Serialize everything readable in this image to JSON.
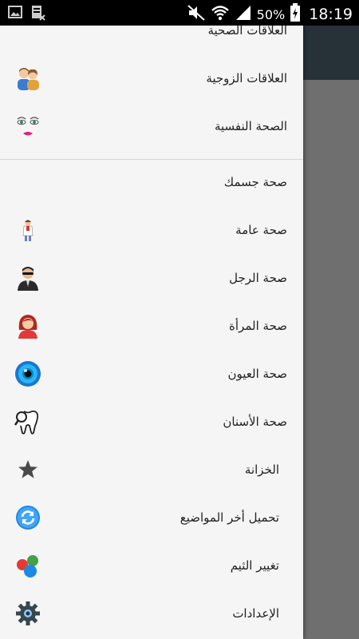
{
  "status_bar": {
    "battery": "50%",
    "time": "18:19",
    "icons": [
      "image-icon",
      "file-x-icon",
      "mute-icon",
      "wifi-icon",
      "signal-icon",
      "battery-charging-icon"
    ]
  },
  "drawer": {
    "group1": [
      {
        "label": "العلاقات الصحية",
        "icon": "none"
      },
      {
        "label": "العلاقات الزوجية",
        "icon": "couple-icon"
      },
      {
        "label": "الصحة النفسية",
        "icon": "face-icon"
      }
    ],
    "group2": [
      {
        "label": "صحة جسمك",
        "icon": "none"
      },
      {
        "label": "صحة عامة",
        "icon": "doctor-icon"
      },
      {
        "label": "صحة الرجل",
        "icon": "man-icon"
      },
      {
        "label": "صحة المرأة",
        "icon": "woman-icon"
      },
      {
        "label": "صحة العيون",
        "icon": "eye-icon"
      },
      {
        "label": "صحة الأسنان",
        "icon": "tooth-icon"
      },
      {
        "label": "الخزانة",
        "icon": "star-icon"
      },
      {
        "label": "تحميل أخر المواضيع",
        "icon": "refresh-icon"
      },
      {
        "label": "تغيير الثيم",
        "icon": "theme-balls-icon"
      },
      {
        "label": "الإعدادات",
        "icon": "gear-icon"
      }
    ]
  },
  "colors": {
    "drawer_bg": "#f5f5f5",
    "scrim": "#6f6f6f",
    "toolbar": "#263238",
    "status_bar": "#000000"
  }
}
